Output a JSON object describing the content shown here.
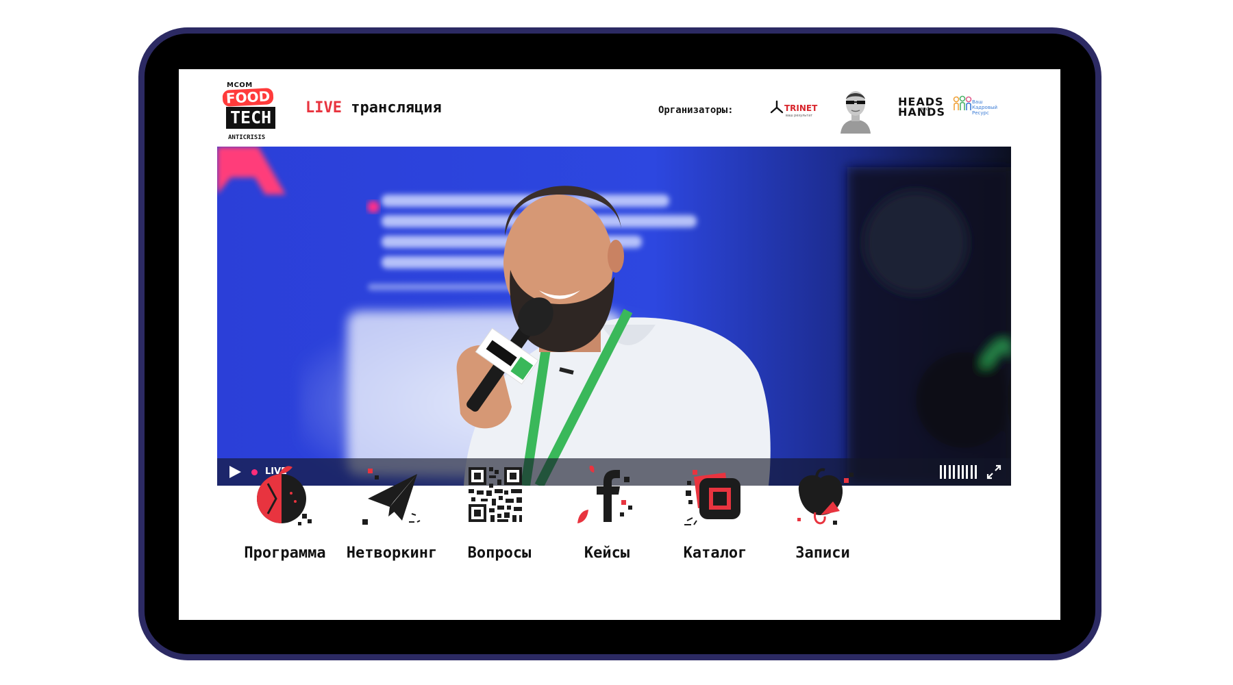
{
  "header": {
    "logo": {
      "top": "MCOM",
      "food": "FOOD",
      "tech": "TECH",
      "sub": "ANTICRISIS"
    },
    "live_word": "LIVE",
    "title_rest": "трансляция",
    "organizers_label": "Организаторы:",
    "organizers": [
      {
        "name": "TRINET",
        "sub": "ваш результат",
        "icon": "trinet-logo"
      },
      {
        "icon": "avatar-sunglasses"
      },
      {
        "line1": "HEADS",
        "and": "and",
        "line2": "HANDS"
      },
      {
        "text": [
          "Ваш",
          "Кадровый",
          "Ресурс"
        ],
        "icon": "people-logo"
      }
    ]
  },
  "video": {
    "status": "LIVE",
    "live_color": "#ff2d7a",
    "volume_level": 9
  },
  "nav": {
    "items": [
      {
        "label": "Программа",
        "icon": "fruit-head-icon"
      },
      {
        "label": "Нетворкинг",
        "icon": "paper-plane-icon"
      },
      {
        "label": "Вопросы",
        "icon": "qr-code-icon"
      },
      {
        "label": "Кейсы",
        "icon": "facebook-f-icon"
      },
      {
        "label": "Каталог",
        "icon": "stack-squares-icon"
      },
      {
        "label": "Записи",
        "icon": "bell-pepper-icon"
      }
    ]
  },
  "colors": {
    "accent": "#e8343f",
    "frame": "#2c2a63",
    "dark": "#111111"
  }
}
